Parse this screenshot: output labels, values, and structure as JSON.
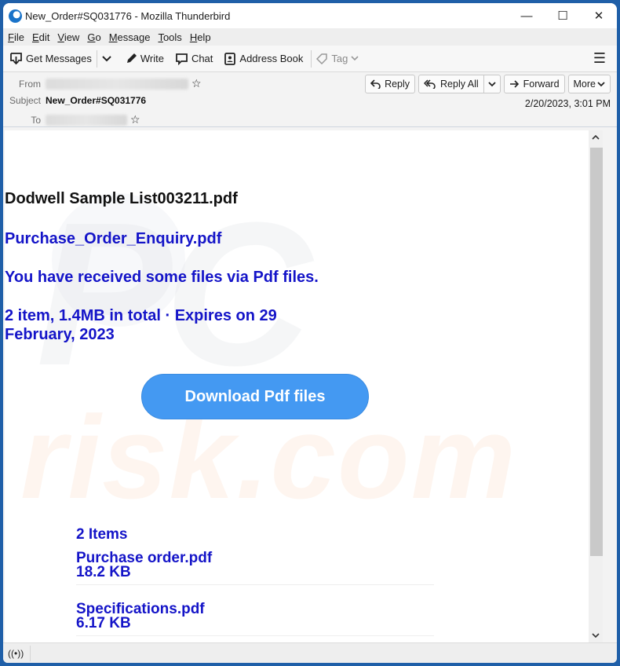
{
  "window": {
    "title": "New_Order#SQ031776 - Mozilla Thunderbird",
    "controls": {
      "minimize": "—",
      "maximize": "☐",
      "close": "✕"
    }
  },
  "menubar": {
    "items": [
      {
        "label": "File",
        "accel": "F",
        "rest": "ile"
      },
      {
        "label": "Edit",
        "accel": "E",
        "rest": "dit"
      },
      {
        "label": "View",
        "accel": "V",
        "rest": "iew"
      },
      {
        "label": "Go",
        "accel": "G",
        "rest": "o"
      },
      {
        "label": "Message",
        "accel": "M",
        "rest": "essage"
      },
      {
        "label": "Tools",
        "accel": "T",
        "rest": "ools"
      },
      {
        "label": "Help",
        "accel": "H",
        "rest": "elp"
      }
    ]
  },
  "toolbar": {
    "get_messages": "Get Messages",
    "write": "Write",
    "chat": "Chat",
    "address_book": "Address Book",
    "tag": "Tag"
  },
  "header": {
    "from_label": "From",
    "subject_label": "Subject",
    "to_label": "To",
    "subject": "New_Order#SQ031776",
    "date": "2/20/2023, 3:01 PM",
    "actions": {
      "reply": "Reply",
      "reply_all": "Reply All",
      "forward": "Forward",
      "more": "More"
    }
  },
  "email": {
    "title": "Dodwell Sample List003211.pdf",
    "filename": "Purchase_Order_Enquiry.pdf",
    "received": "You have received some files via Pdf files.",
    "summary_line1": "2 item, 1.4MB in total  ·  Expires on 29",
    "summary_line2": "February, 2023",
    "download_button": "Download Pdf files",
    "items_count": "2 Items",
    "files": [
      {
        "name": "Purchase order.pdf",
        "size": "18.2 KB"
      },
      {
        "name": "Specifications.pdf",
        "size": "6.17 KB"
      }
    ]
  },
  "watermark": {
    "top": "PC",
    "bottom": "risk.com"
  },
  "colors": {
    "link_blue": "#1414c8",
    "button_blue": "#4499f2",
    "window_frame": "#1f5fa8"
  }
}
